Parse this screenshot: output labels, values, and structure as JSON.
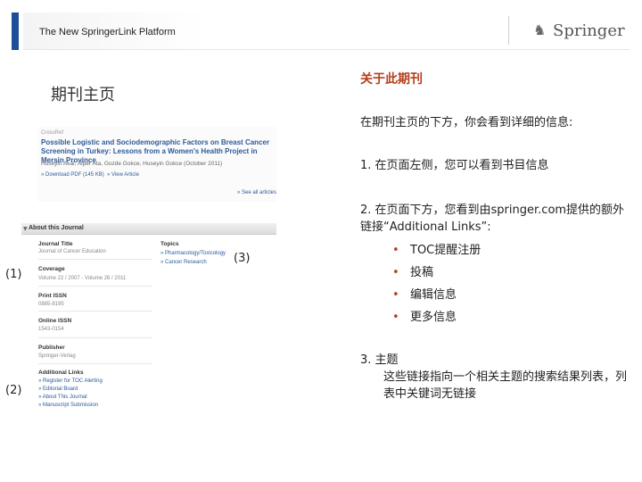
{
  "header": {
    "title": "The New SpringerLink Platform",
    "logo_text": "Springer",
    "logo_icon": "horse-icon"
  },
  "page_heading": "期刊主页",
  "screenshot": {
    "cross_label": "CrossRef",
    "article_title": "Possible Logistic and Sociodemographic Factors on Breast Cancer Screening in Turkey: Lessons from a Women's Health Project in Mersin Province",
    "authors": "Huseyin Akal, Alper Ata, Gozde Gokce, Huseyin Gokce (October 2011)",
    "download": "» Download PDF (145 KB)",
    "view": "» View Article",
    "see_all": "» See all articles",
    "about_title": "About this Journal",
    "journal_title_label": "Journal Title",
    "journal_title_value": "Journal of Cancer Education",
    "coverage_label": "Coverage",
    "coverage_value": "Volume 22 / 2007 - Volume 26 / 2011",
    "print_issn_label": "Print ISSN",
    "print_issn_value": "0885-8195",
    "online_issn_label": "Online ISSN",
    "online_issn_value": "1543-0154",
    "publisher_label": "Publisher",
    "publisher_value": "Springer-Verlag",
    "additional_links_label": "Additional Links",
    "additional_links": [
      "» Register for TOC Alerting",
      "» Editorial Board",
      "» About This Journal",
      "» Manuscript Submission"
    ],
    "topics_label": "Topics",
    "topics": [
      "» Pharmacology/Toxicology",
      "» Cancer Research"
    ]
  },
  "callouts": {
    "c1": "(1)",
    "c2": "(2)",
    "c3": "(3)"
  },
  "panel": {
    "title": "关于此期刊",
    "intro": "在期刊主页的下方，你会看到详细的信息:",
    "item1": "1.  在页面左侧，您可以看到书目信息",
    "item2": "2.  在页面下方，您看到由springer.com提供的额外链接“Additional Links”:",
    "bullets": [
      "TOC提醒注册",
      "投稿",
      "编辑信息",
      "更多信息"
    ],
    "bullet_glyph": "•",
    "item3_head": "3. 主题",
    "item3_body": "这些链接指向一个相关主题的搜索结果列表，列表中关键词无链接"
  }
}
